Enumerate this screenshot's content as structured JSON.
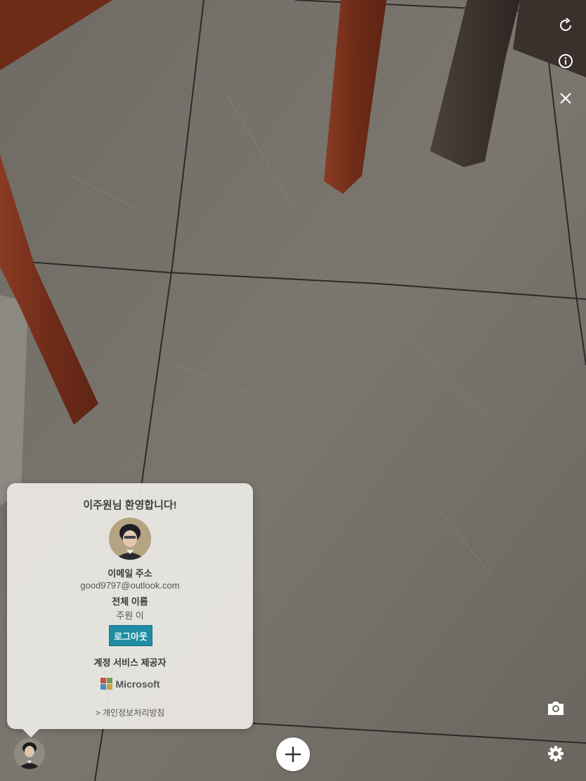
{
  "top_controls": {
    "refresh_icon": "refresh-icon",
    "info_icon": "info-icon",
    "close_icon": "close-icon"
  },
  "account_popover": {
    "welcome": "이주원님 환영합니다!",
    "email_label": "이메일 주소",
    "email_value": "good9797@outlook.com",
    "name_label": "전체 이름",
    "name_value": "주원 이",
    "logout_label": "로그아웃",
    "provider_label": "계정 서비스 제공자",
    "provider_name": "Microsoft",
    "privacy_link": "> 개인정보처리방침"
  },
  "bottom_controls": {
    "add_icon": "plus-icon",
    "camera_icon": "camera-icon",
    "settings_icon": "gear-icon"
  },
  "colors": {
    "logout_button": "#1f8ca3",
    "floor": "#77736c",
    "wood_leg": "#7a3320",
    "dark_leg": "#3d3430"
  }
}
